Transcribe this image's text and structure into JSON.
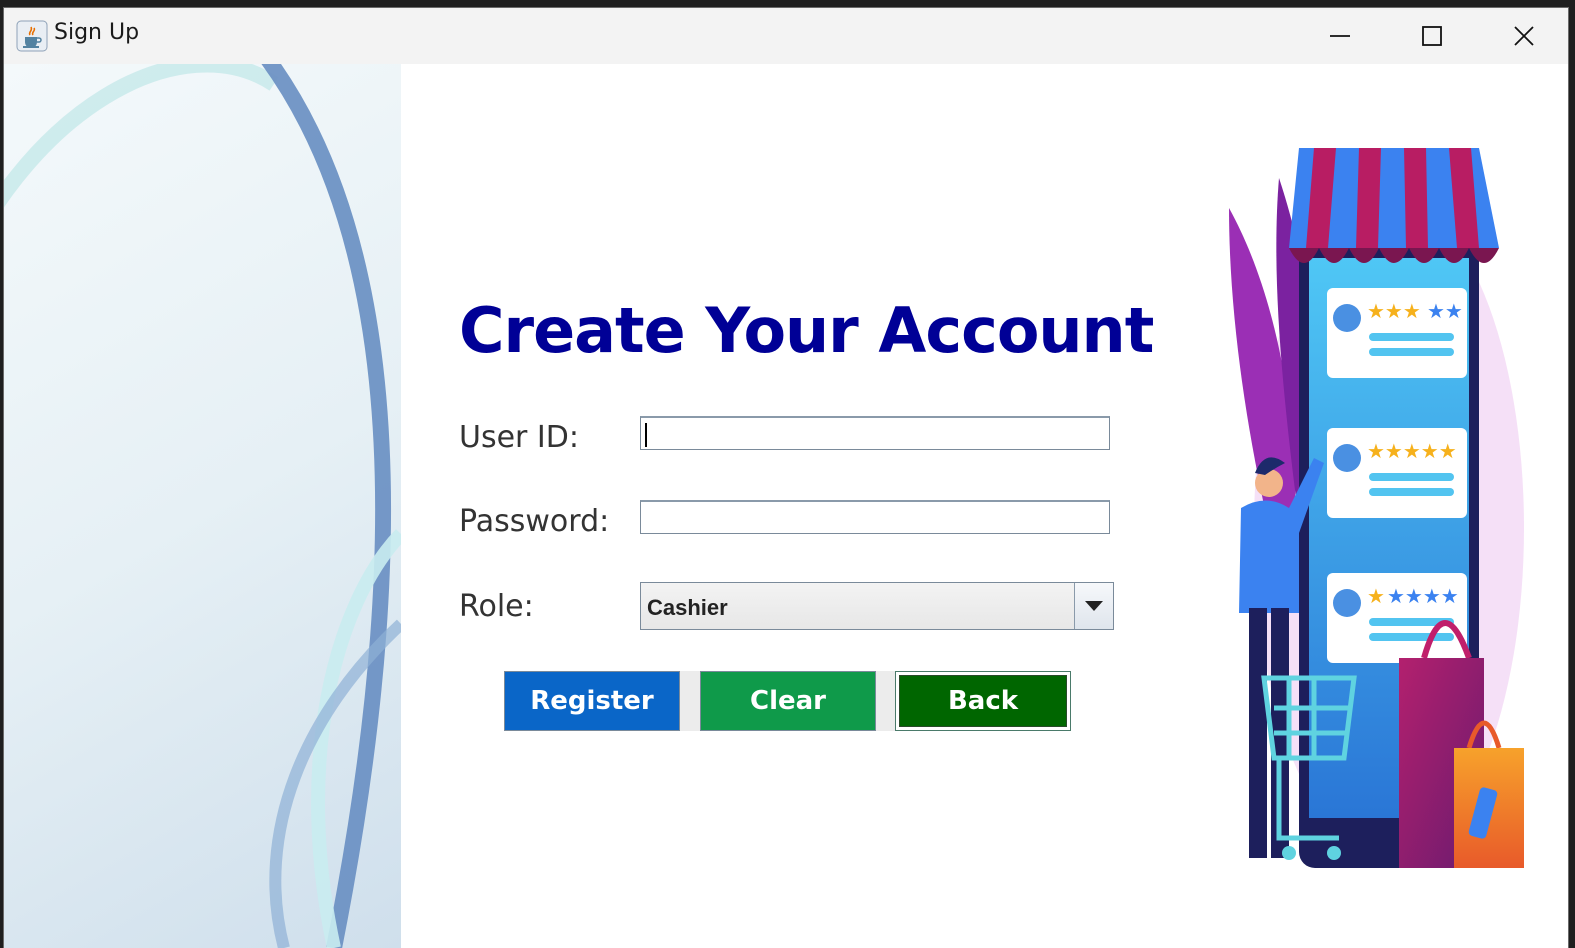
{
  "window": {
    "title": "Sign Up",
    "icon": "java-cup-icon",
    "controls": [
      "minimize-icon",
      "maximize-icon",
      "close-icon"
    ]
  },
  "form": {
    "heading": "Create Your Account",
    "user_id_label": "User ID:",
    "user_id_value": "",
    "password_label": "Password:",
    "password_value": "",
    "role_label": "Role:",
    "role_value": "Cashier"
  },
  "buttons": {
    "register": "Register",
    "clear": "Clear",
    "back": "Back"
  },
  "colors": {
    "heading": "#000096",
    "register_bg": "#0a66c8",
    "clear_bg": "#0f9a4a",
    "back_bg": "#006600"
  },
  "illustration": {
    "subject": "shopping-review-illustration"
  }
}
